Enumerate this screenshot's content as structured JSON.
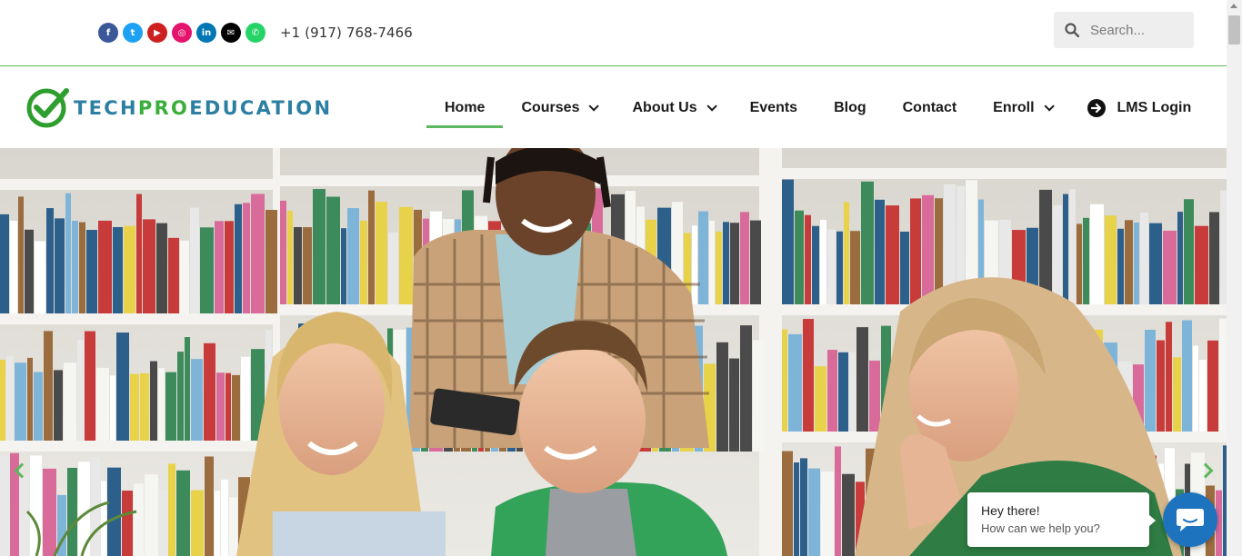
{
  "topbar": {
    "socials": [
      {
        "name": "facebook-icon",
        "glyph": "f",
        "color": "#3b5998"
      },
      {
        "name": "twitter-icon",
        "glyph": "t",
        "color": "#1da1f2"
      },
      {
        "name": "youtube-icon",
        "glyph": "▶",
        "color": "#cd201f"
      },
      {
        "name": "instagram-icon",
        "glyph": "◎",
        "color": "#e4146c"
      },
      {
        "name": "linkedin-icon",
        "glyph": "in",
        "color": "#0077b5"
      },
      {
        "name": "envelope-icon",
        "glyph": "✉",
        "color": "#000000"
      },
      {
        "name": "whatsapp-icon",
        "glyph": "✆",
        "color": "#25d366"
      }
    ],
    "phone": "+1 (917) 768-7466",
    "search_placeholder": "Search..."
  },
  "logo": {
    "part1": "TECH",
    "part2": "PRO",
    "part3": "EDUCATION"
  },
  "nav": {
    "items": [
      {
        "label": "Home",
        "dropdown": false,
        "active": true
      },
      {
        "label": "Courses",
        "dropdown": true,
        "active": false
      },
      {
        "label": "About Us",
        "dropdown": true,
        "active": false
      },
      {
        "label": "Events",
        "dropdown": false,
        "active": false
      },
      {
        "label": "Blog",
        "dropdown": false,
        "active": false
      },
      {
        "label": "Contact",
        "dropdown": false,
        "active": false
      },
      {
        "label": "Enroll",
        "dropdown": true,
        "active": false
      }
    ],
    "lms_label": "LMS Login"
  },
  "chat": {
    "title": "Hey there!",
    "subtitle": "How can we help you?"
  },
  "colors": {
    "accent": "#5cb85c",
    "chat": "#1e73be"
  }
}
